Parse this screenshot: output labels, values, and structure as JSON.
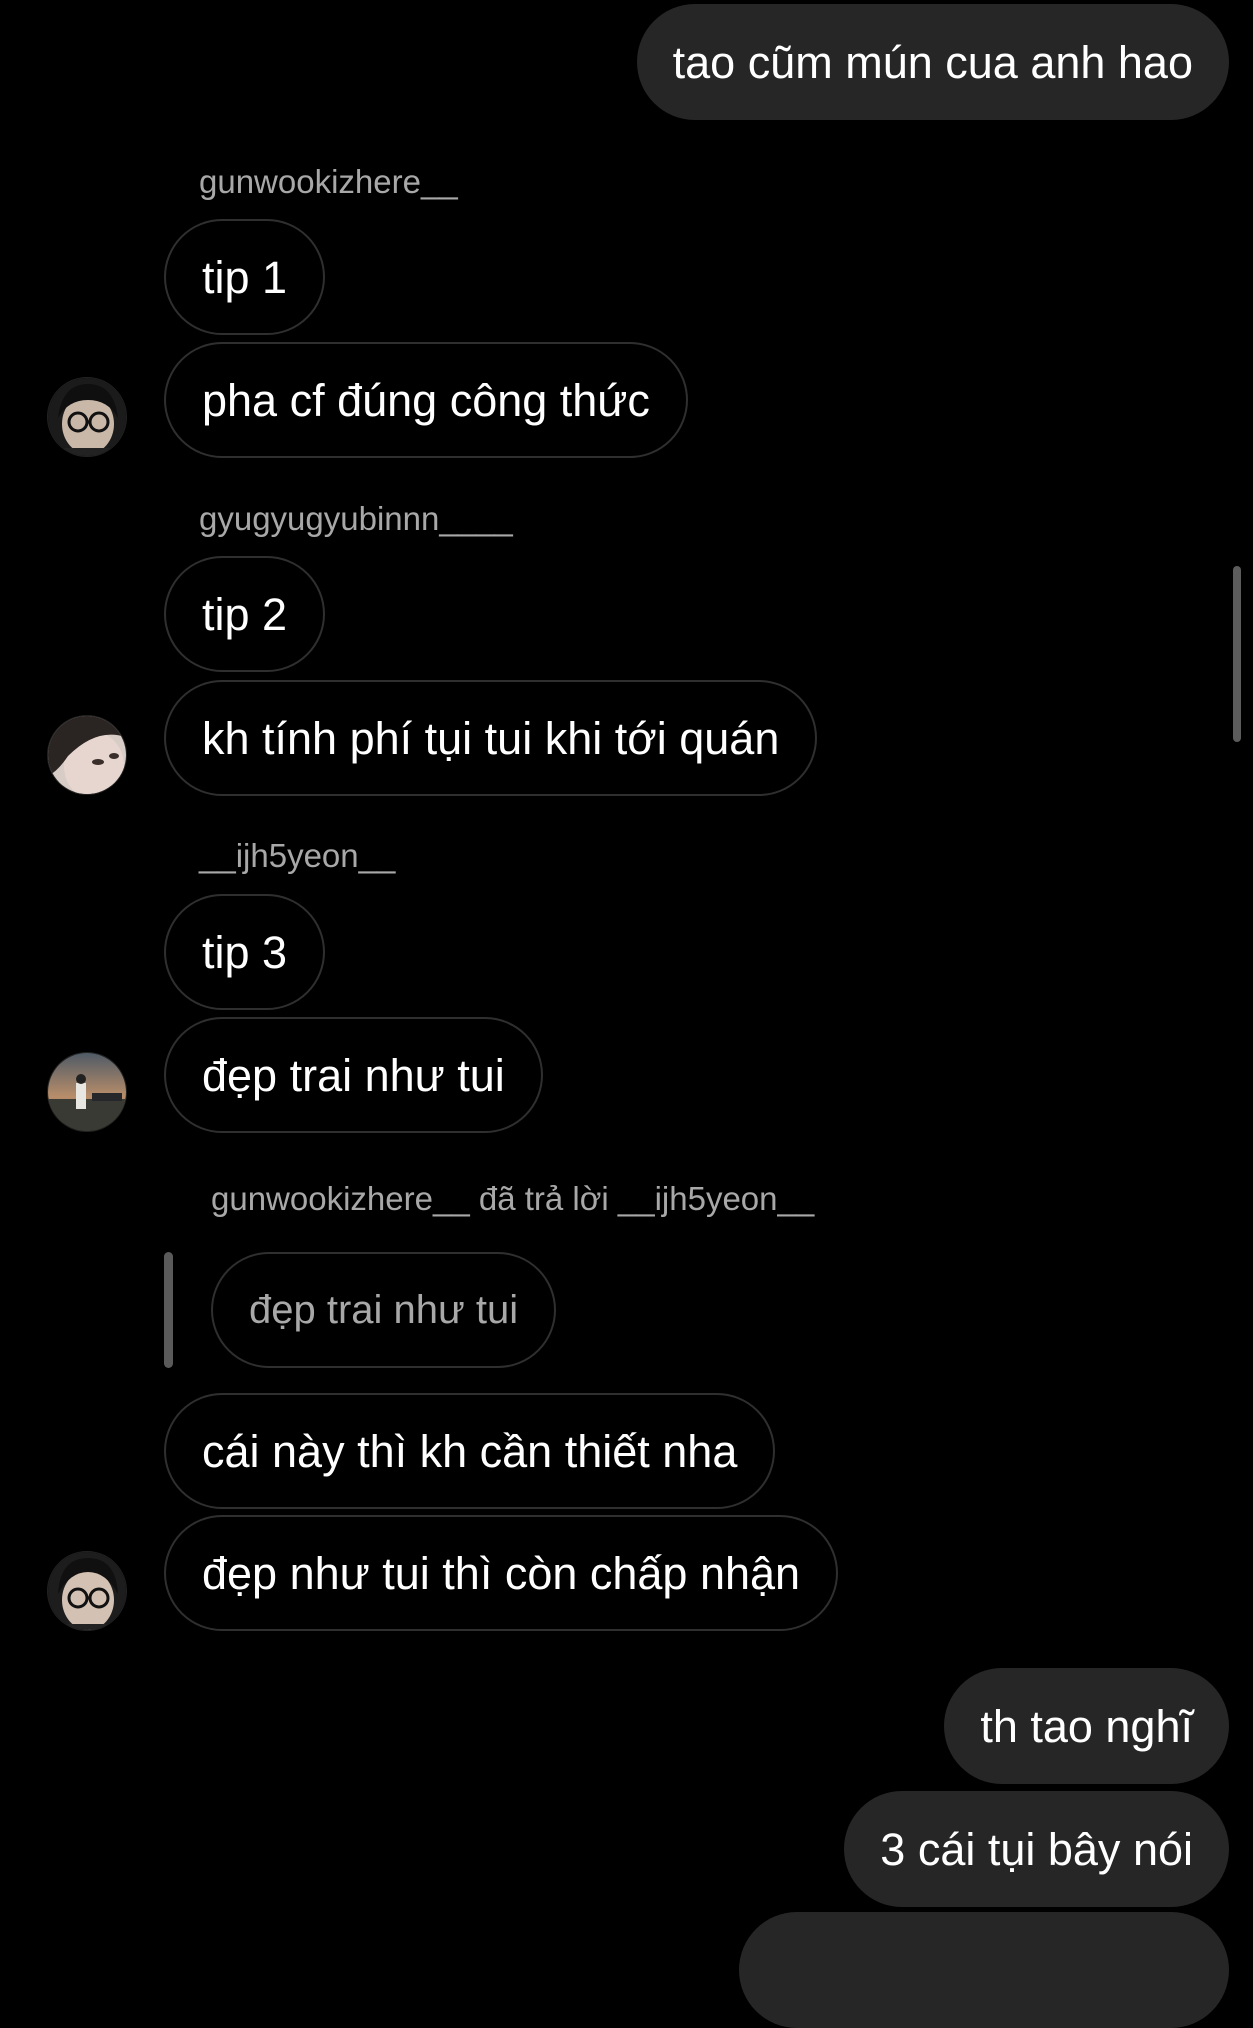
{
  "theme": {
    "background": "#000000",
    "sent_bubble": "#262626",
    "received_border": "#2f2f2f",
    "secondary_text": "#a8a8a8"
  },
  "messages": {
    "m1": {
      "text": "tao cũm mún cua anh hao"
    },
    "s1": {
      "sender": "gunwookizhere__"
    },
    "m2": {
      "text": "tip 1"
    },
    "m3": {
      "text": "pha cf đúng công thức"
    },
    "s2": {
      "sender": "gyugyugyubinnn____"
    },
    "m4": {
      "text": "tip 2"
    },
    "m5": {
      "text": "kh tính phí tụi tui khi tới quán"
    },
    "s3": {
      "sender": "__ijh5yeon__"
    },
    "m6": {
      "text": "tip 3"
    },
    "m7": {
      "text": "đẹp trai như tui"
    },
    "r1": {
      "label": "gunwookizhere__ đã trả lời __ijh5yeon__",
      "quoted_text": "đẹp trai như tui"
    },
    "m8": {
      "text": "cái này thì kh cần thiết nha"
    },
    "m9": {
      "text": "đẹp như tui thì còn chấp nhận"
    },
    "m10": {
      "text": "th tao nghĩ"
    },
    "m11": {
      "text": "3 cái tụi bây nói"
    }
  },
  "avatars": {
    "a1": {
      "icon": "profile-photo-glasses"
    },
    "a2": {
      "icon": "profile-photo-face"
    },
    "a3": {
      "icon": "profile-photo-sunset"
    },
    "a4": {
      "icon": "profile-photo-glasses"
    }
  }
}
